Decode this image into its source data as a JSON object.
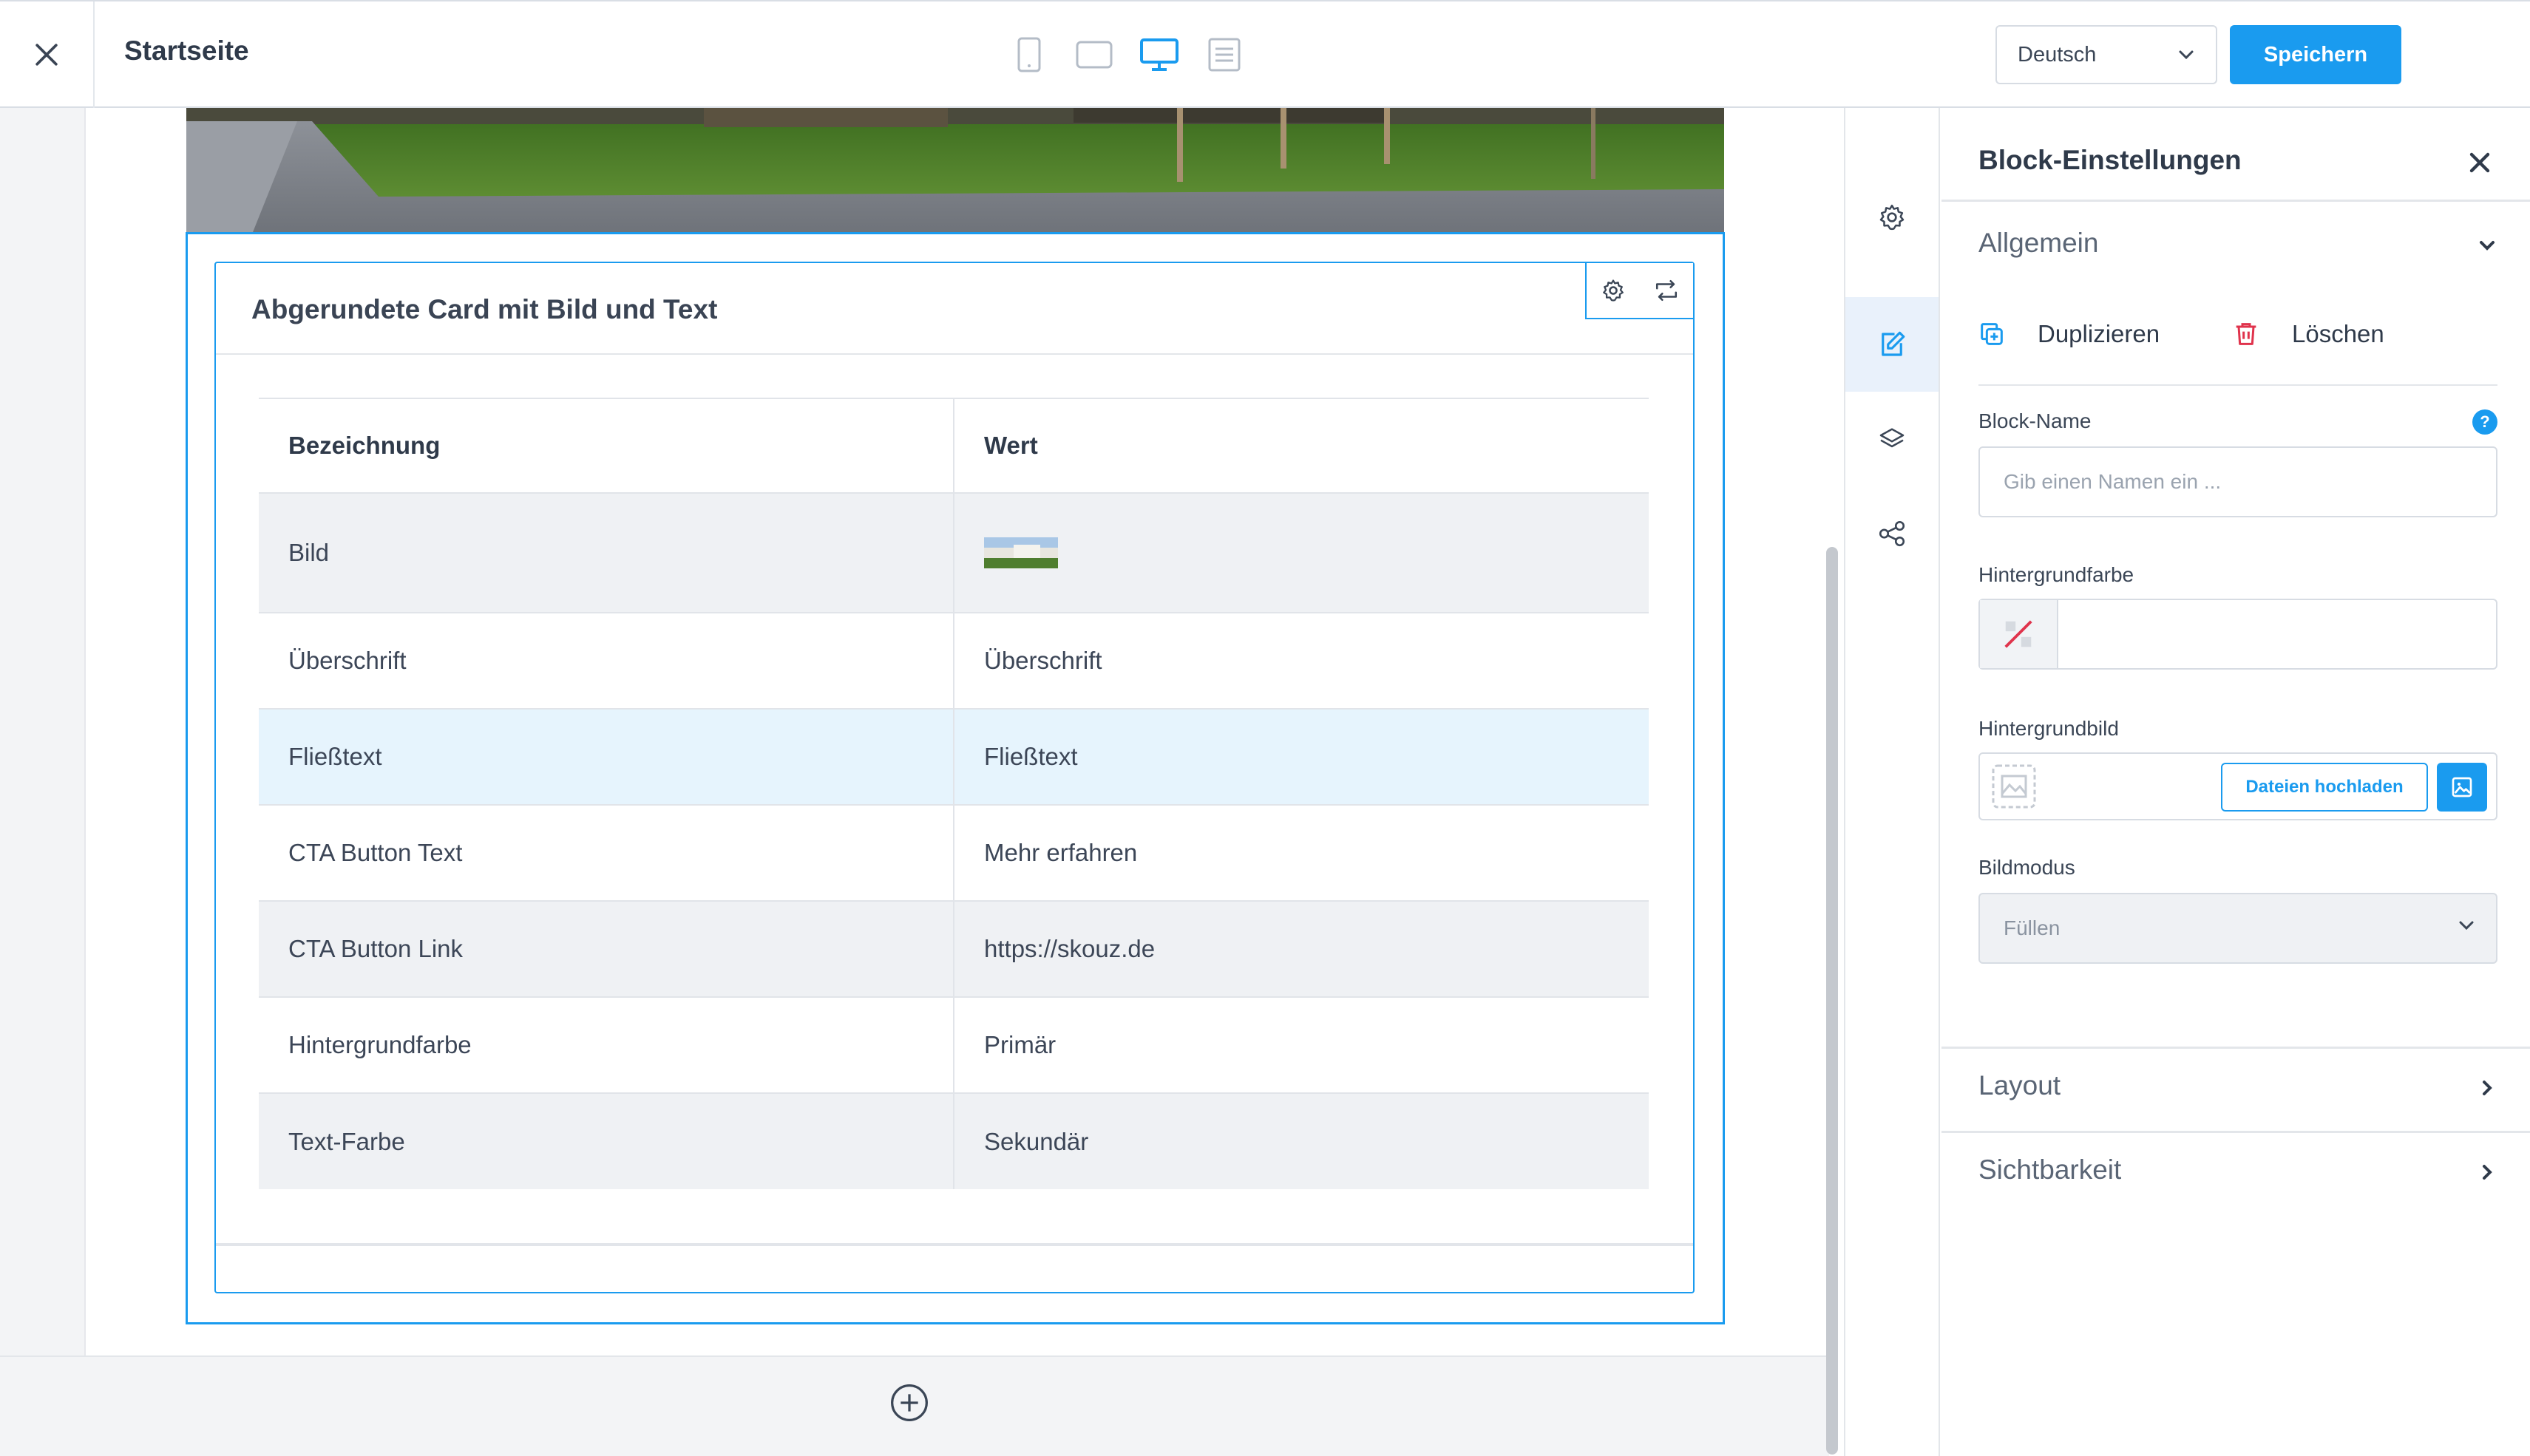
{
  "header": {
    "title": "Startseite",
    "language": "Deutsch",
    "save_label": "Speichern"
  },
  "card": {
    "title": "Abgerundete Card mit Bild und Text",
    "table": {
      "headers": [
        "Bezeichnung",
        "Wert"
      ],
      "rows": [
        {
          "label": "Bild",
          "value": ""
        },
        {
          "label": "Überschrift",
          "value": "Überschrift"
        },
        {
          "label": "Fließtext",
          "value": "Fließtext"
        },
        {
          "label": "CTA Button Text",
          "value": "Mehr erfahren"
        },
        {
          "label": "CTA Button Link",
          "value": "https://skouz.de"
        },
        {
          "label": "Hintergrundfarbe",
          "value": "Primär"
        },
        {
          "label": "Text-Farbe",
          "value": "Sekundär"
        }
      ]
    }
  },
  "panel": {
    "title": "Block-Einstellungen",
    "general": {
      "title": "Allgemein",
      "duplicate_label": "Duplizieren",
      "delete_label": "Löschen",
      "block_name_label": "Block-Name",
      "block_name_placeholder": "Gib einen Namen ein ...",
      "help_symbol": "?",
      "bg_color_label": "Hintergrundfarbe",
      "bg_image_label": "Hintergrundbild",
      "upload_label": "Dateien hochladen",
      "image_mode_label": "Bildmodus",
      "image_mode_value": "Füllen"
    },
    "layout_title": "Layout",
    "visibility_title": "Sichtbarkeit"
  },
  "rail": {
    "icons": [
      "settings-icon",
      "add-icon",
      "edit-icon",
      "layers-icon",
      "share-icon"
    ],
    "active": "edit-icon"
  },
  "colors": {
    "accent": "#1a9bef",
    "delete": "#e0334c",
    "text": "#2f3a4a",
    "active_rail_bg": "#e9f1fb"
  }
}
